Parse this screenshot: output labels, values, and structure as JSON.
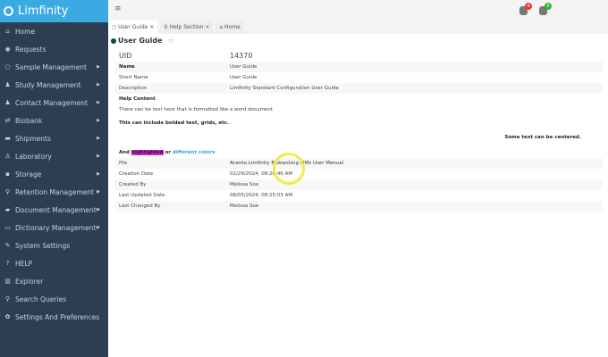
{
  "app": {
    "name": "Limfinity",
    "accent": "#3ba9e2"
  },
  "sidebar": {
    "items": [
      {
        "label": "Home",
        "icon": "home-icon",
        "sub": false
      },
      {
        "label": "Requests",
        "icon": "requests-icon",
        "sub": false
      },
      {
        "label": "Sample Management",
        "icon": "circle-icon",
        "sub": true
      },
      {
        "label": "Study Management",
        "icon": "study-icon",
        "sub": true
      },
      {
        "label": "Contact Management",
        "icon": "user-icon",
        "sub": true
      },
      {
        "label": "Biobank",
        "icon": "biobank-icon",
        "sub": true
      },
      {
        "label": "Shipments",
        "icon": "truck-icon",
        "sub": true
      },
      {
        "label": "Laboratory",
        "icon": "lab-icon",
        "sub": true
      },
      {
        "label": "Storage",
        "icon": "storage-icon",
        "sub": true
      },
      {
        "label": "Retention Management",
        "icon": "search-icon",
        "sub": true
      },
      {
        "label": "Document Management",
        "icon": "folder-icon",
        "sub": true
      },
      {
        "label": "Dictionary Management",
        "icon": "dictionary-icon",
        "sub": true
      },
      {
        "label": "System Settings",
        "icon": "wrench-icon",
        "sub": false
      },
      {
        "label": "HELP",
        "icon": "help-icon",
        "sub": false
      },
      {
        "label": "Explorer",
        "icon": "map-icon",
        "sub": false
      },
      {
        "label": "Search Queries",
        "icon": "search-icon",
        "sub": false
      },
      {
        "label": "Settings And Preferences",
        "icon": "gear-icon",
        "sub": false
      }
    ]
  },
  "topbar": {
    "alerts_count": "4",
    "tasks_count": "0"
  },
  "tabs": [
    {
      "label": "User Guide"
    },
    {
      "label": "Help Section"
    },
    {
      "label": "Home"
    }
  ],
  "page": {
    "title": "User Guide"
  },
  "fields": {
    "uid_label": "UID",
    "uid": "14370",
    "rows": [
      {
        "label": "Name",
        "value": "User Guide"
      },
      {
        "label": "Short Name",
        "value": "User Guide"
      },
      {
        "label": "Description",
        "value": "Limfinity Standard Configuration User Guide"
      }
    ],
    "help_label": "Help Content",
    "help_line1": "There can be text here that is formatted like a word document",
    "help_line2": "This can include bolded text, grids, etc.",
    "help_centered": "Some text can be centered.",
    "help_and": "And",
    "help_highlighted": "highlighted",
    "help_or": "or",
    "help_colors": "different colors",
    "rows2": [
      {
        "label": "File",
        "value": "Acenta Limfinity Biobanking LIMs User Manual"
      },
      {
        "label": "Creation Date",
        "value": "02/29/2024, 08:20:46 AM"
      },
      {
        "label": "Created By",
        "value": "Melissa Soe"
      },
      {
        "label": "Last Updated Date",
        "value": "08/05/2024, 08:25:03 AM"
      },
      {
        "label": "Last Changed By",
        "value": "Melissa Soe"
      }
    ]
  }
}
